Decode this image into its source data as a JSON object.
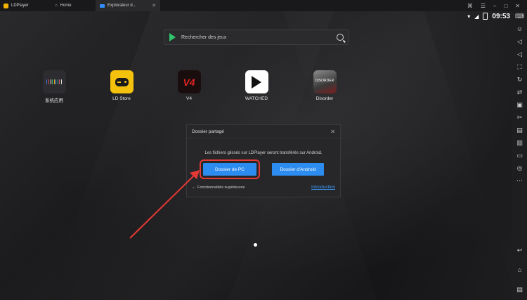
{
  "titlebar": {
    "app_name": "LDPlayer",
    "tabs": [
      {
        "label": "Home",
        "icon": "home-icon"
      },
      {
        "label": "Explorateur d...",
        "icon": "folder-icon"
      }
    ]
  },
  "status": {
    "time": "09:53"
  },
  "search": {
    "placeholder": "Rechercher des jeux"
  },
  "apps": [
    {
      "label": "系统应用"
    },
    {
      "label": "LD Store"
    },
    {
      "label": "V4",
      "icon_text": "V4"
    },
    {
      "label": "WATCHED"
    },
    {
      "label": "Disorder",
      "icon_text": "DISORDER"
    }
  ],
  "dialog": {
    "title": "Dossier partagé",
    "message": "Les fichiers glissés sur LDPlayer seront transférés sur Android.",
    "pc_button": "Dossier de PC",
    "android_button": "Dossier d'Android",
    "advanced": "Fonctionnalités supérieures",
    "intro_link": "Introduction"
  },
  "colors": {
    "accent": "#2d8cf0",
    "highlight": "#e53935",
    "link": "#3b9cff"
  }
}
